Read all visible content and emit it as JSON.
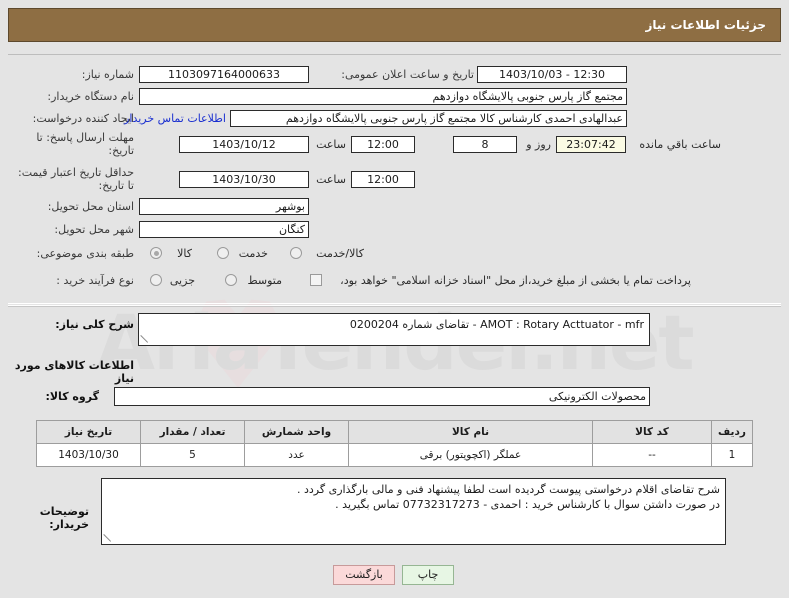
{
  "header": {
    "title": "جزئیات اطلاعات نیاز"
  },
  "form": {
    "need_number_label": "شماره نیاز:",
    "need_number_value": "1103097164000633",
    "announce_label": "تاریخ و ساعت اعلان عمومی:",
    "announce_value": "12:30 - 1403/10/03",
    "buyer_org_label": "نام دستگاه خریدار:",
    "buyer_org_value": "مجتمع گاز پارس جنوبی  پالایشگاه دوازدهم",
    "buyer_org_value2": "",
    "creator_label": "ایجاد کننده درخواست:",
    "creator_value": "عبدالهادی احمدی کارشناس کالا مجتمع گاز پارس جنوبی  پالایشگاه دوازدهم",
    "contact_link": "اطلاعات تماس خریدار",
    "reply_deadline_label": "مهلت ارسال پاسخ: تا تاریخ:",
    "reply_deadline_date": "1403/10/12",
    "hour_label": "ساعت",
    "reply_deadline_time": "12:00",
    "days_remaining": "8",
    "days_word": "روز و",
    "countdown": "23:07:42",
    "remaining_label": "ساعت باقي مانده",
    "price_valid_label": "حداقل تاریخ اعتبار قیمت: تا تاریخ:",
    "price_valid_date": "1403/10/30",
    "price_valid_time": "12:00",
    "province_label": "استان محل تحویل:",
    "province_value": "بوشهر",
    "city_label": "شهر محل تحویل:",
    "city_value": "کنگان",
    "classification_label": "طبقه بندی موضوعی:",
    "classification_options": [
      {
        "label": "کالا",
        "selected": true
      },
      {
        "label": "خدمت",
        "selected": false
      },
      {
        "label": "کالا/خدمت",
        "selected": false
      }
    ],
    "process_label": "نوع فرآیند خرید :",
    "process_options": [
      {
        "label": "جزیی",
        "selected": false
      },
      {
        "label": "متوسط",
        "selected": false
      }
    ],
    "treasury_checkbox_label": "پرداخت تمام یا بخشی از مبلغ خرید،از محل \"اسناد خزانه اسلامی\" خواهد بود،",
    "treasury_checked": false
  },
  "summary": {
    "label": "شرح کلی نیاز:",
    "value": "AMOT : Rotary Acttuator - mfr -  تقاضای شماره 0200204"
  },
  "goods_section": {
    "heading": "اطلاعات کالاهای مورد نیاز",
    "group_label": "گروه کالا:",
    "group_value": "محصولات الکترونیکی",
    "columns": [
      "ردیف",
      "کد کالا",
      "نام کالا",
      "واحد شمارش",
      "تعداد / مقدار",
      "تاریخ نیاز"
    ],
    "rows": [
      {
        "row": "1",
        "code": "--",
        "name": "عملگر (اکچویتور) برقی",
        "unit": "عدد",
        "qty": "5",
        "need_date": "1403/10/30"
      }
    ]
  },
  "notes": {
    "label": "توضیحات خریدار:",
    "line1": "شرح تقاضای اقلام درخواستی پیوست گردیده است لطفا پیشنهاد فنی و مالی بارگذاری گردد .",
    "line2": "در صورت داشتن سوال با کارشناس خرید : احمدی  - 07732317273 تماس بگیرید ."
  },
  "buttons": {
    "print": "چاپ",
    "back": "بازگشت"
  },
  "watermark": {
    "text": "AriaTender.net"
  }
}
